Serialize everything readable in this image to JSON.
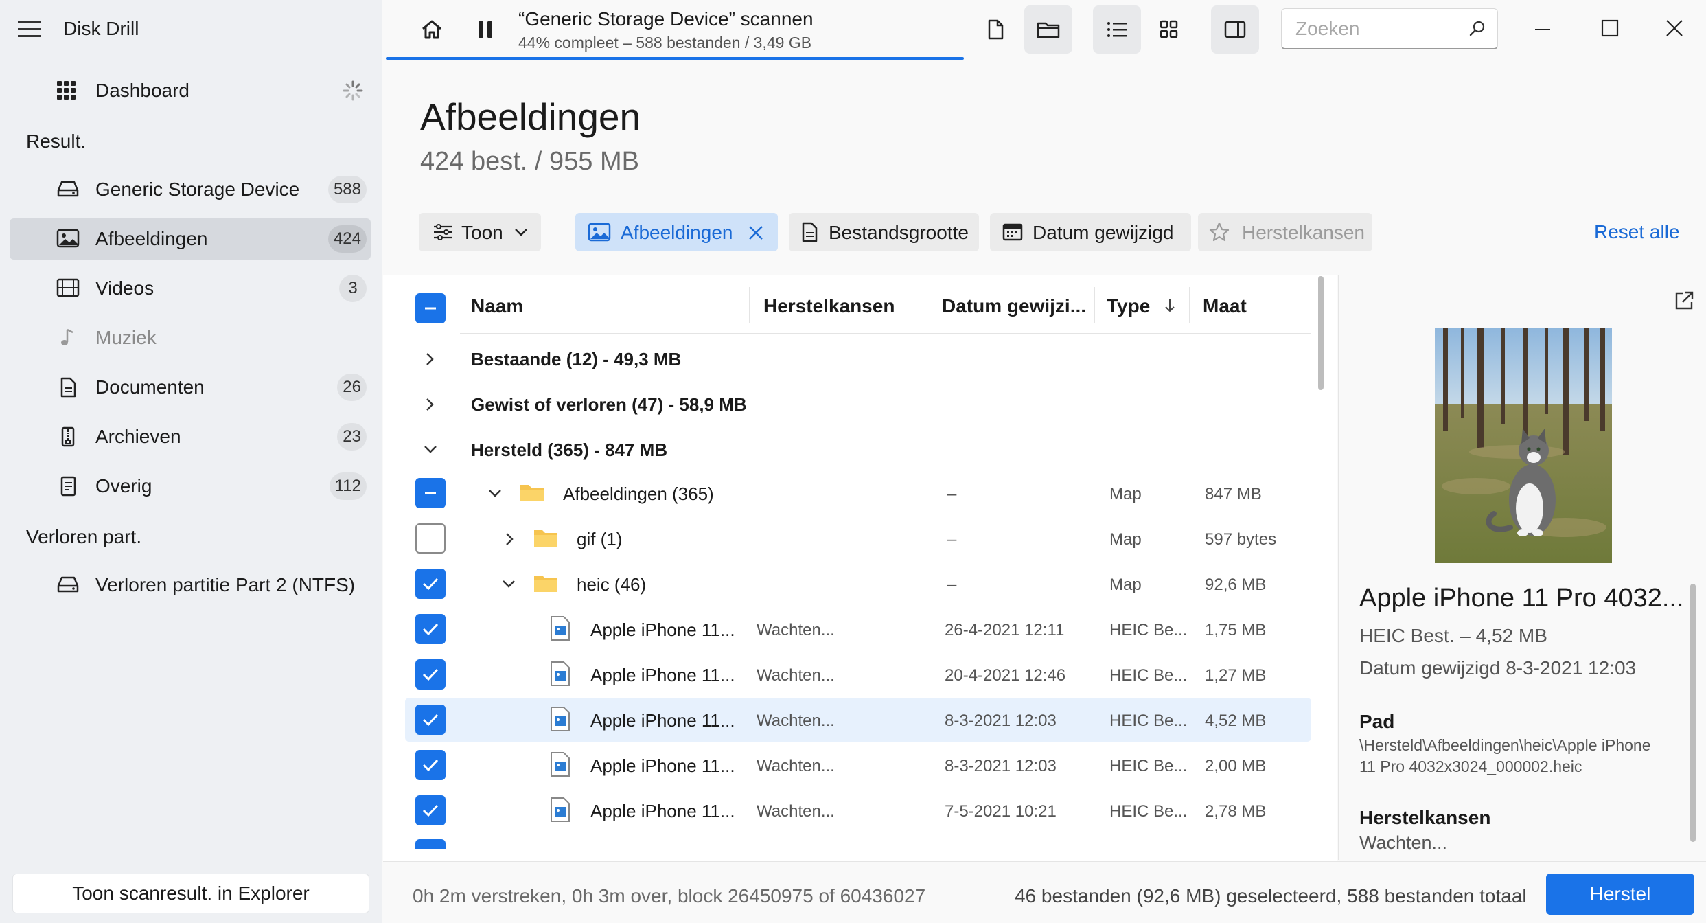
{
  "app": {
    "title": "Disk Drill"
  },
  "sidebar": {
    "dashboard": "Dashboard",
    "result_header": "Result.",
    "items": [
      {
        "label": "Generic Storage Device",
        "count": "588"
      },
      {
        "label": "Afbeeldingen",
        "count": "424"
      },
      {
        "label": "Videos",
        "count": "3"
      },
      {
        "label": "Muziek",
        "count": ""
      },
      {
        "label": "Documenten",
        "count": "26"
      },
      {
        "label": "Archieven",
        "count": "23"
      },
      {
        "label": "Overig",
        "count": "112"
      }
    ],
    "lost_header": "Verloren part.",
    "lost_item": "Verloren partitie Part 2 (NTFS)",
    "show_explorer": "Toon scanresult. in Explorer"
  },
  "scan": {
    "title": "“Generic Storage Device” scannen",
    "subtitle": "44% compleet – 588 bestanden / 3,49 GB",
    "progress": 0.44
  },
  "search": {
    "placeholder": "Zoeken"
  },
  "header": {
    "title": "Afbeeldingen",
    "subtitle": "424 best. / 955 MB"
  },
  "filters": {
    "show": "Toon",
    "images": "Afbeeldingen",
    "size": "Bestandsgrootte",
    "date": "Datum gewijzigd",
    "chances": "Herstelkansen",
    "reset": "Reset alle"
  },
  "table": {
    "columns": {
      "name": "Naam",
      "chances": "Herstelkansen",
      "date": "Datum gewijzi...",
      "type": "Type",
      "size": "Maat"
    },
    "groups": [
      {
        "label": "Bestaande (12) - 49,3 MB"
      },
      {
        "label": "Gewist of verloren (47) - 58,9 MB"
      },
      {
        "label": "Hersteld (365) - 847 MB"
      }
    ],
    "folders": [
      {
        "name": "Afbeeldingen (365)",
        "chances": "–",
        "type": "Map",
        "size": "847 MB"
      },
      {
        "name": "gif (1)",
        "chances": "–",
        "type": "Map",
        "size": "597 bytes"
      },
      {
        "name": "heic (46)",
        "chances": "–",
        "type": "Map",
        "size": "92,6 MB"
      }
    ],
    "files": [
      {
        "name": "Apple iPhone 11...",
        "chances": "Wachten...",
        "date": "26-4-2021 12:11",
        "type": "HEIC Be...",
        "size": "1,75 MB"
      },
      {
        "name": "Apple iPhone 11...",
        "chances": "Wachten...",
        "date": "20-4-2021 12:46",
        "type": "HEIC Be...",
        "size": "1,27 MB"
      },
      {
        "name": "Apple iPhone 11...",
        "chances": "Wachten...",
        "date": "8-3-2021 12:03",
        "type": "HEIC Be...",
        "size": "4,52 MB"
      },
      {
        "name": "Apple iPhone 11...",
        "chances": "Wachten...",
        "date": "8-3-2021 12:03",
        "type": "HEIC Be...",
        "size": "2,00 MB"
      },
      {
        "name": "Apple iPhone 11...",
        "chances": "Wachten...",
        "date": "7-5-2021 10:21",
        "type": "HEIC Be...",
        "size": "2,78 MB"
      }
    ]
  },
  "details": {
    "name": "Apple iPhone 11 Pro 4032...",
    "type": "HEIC Best. – 4,52 MB",
    "date": "Datum gewijzigd 8-3-2021 12:03",
    "path_label": "Pad",
    "path": "\\Hersteld\\Afbeeldingen\\heic\\Apple iPhone 11 Pro 4032x3024_000002.heic",
    "chances_label": "Herstelkansen",
    "chances": "Wachten..."
  },
  "status": {
    "elapsed": "0h 2m verstreken, 0h 3m over, block 26450975 of 60436027",
    "selection": "46 bestanden (92,6 MB) geselecteerd, 588 bestanden totaal",
    "recover": "Herstel"
  },
  "colors": {
    "accent": "#1a73e8",
    "folder": "#f6c44f",
    "sidebar": "#eef0f3"
  },
  "icons": [
    "menu-icon",
    "grid-icon",
    "spinner-icon",
    "drive-icon",
    "image-icon",
    "film-icon",
    "music-icon",
    "document-icon",
    "archive-icon",
    "other-icon",
    "home-icon",
    "pause-icon",
    "file-icon",
    "folder-icon",
    "list-icon",
    "thumbnails-icon",
    "panel-icon",
    "search-icon",
    "minimize-icon",
    "maximize-icon",
    "close-icon",
    "external-link-icon"
  ]
}
